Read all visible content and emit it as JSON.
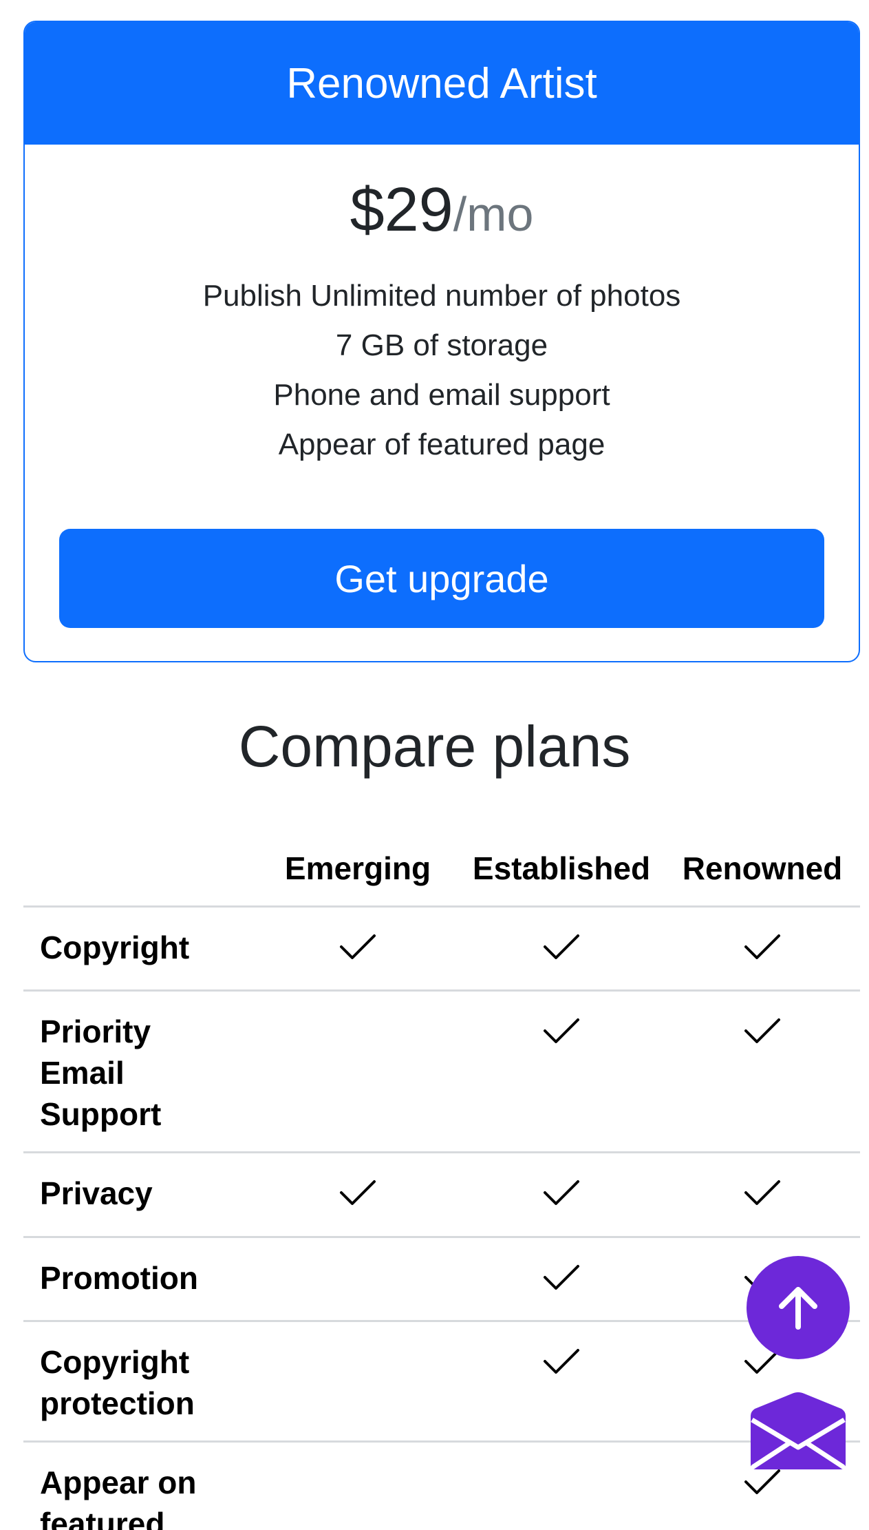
{
  "plan_card": {
    "title": "Renowned Artist",
    "price": "$29",
    "period": "/mo",
    "features": [
      "Publish Unlimited number of photos",
      "7 GB of storage",
      "Phone and email support",
      "Appear of featured page"
    ],
    "button_label": "Get upgrade"
  },
  "compare": {
    "title": "Compare plans",
    "columns": [
      "Emerging",
      "Established",
      "Renowned"
    ],
    "rows": [
      {
        "label": "Copyright",
        "checks": [
          true,
          true,
          true
        ]
      },
      {
        "label": "Priority Email Support",
        "checks": [
          false,
          true,
          true
        ]
      },
      {
        "label": "Privacy",
        "checks": [
          true,
          true,
          true
        ]
      },
      {
        "label": "Promotion",
        "checks": [
          false,
          true,
          true
        ]
      },
      {
        "label": "Copyright protection",
        "checks": [
          false,
          true,
          true
        ]
      },
      {
        "label": "Appear on featured",
        "checks": [
          false,
          false,
          true
        ]
      }
    ]
  },
  "floating_actions": {
    "scroll_top_icon": "arrow-up-icon",
    "mail_icon": "envelope-open-icon",
    "color": "#6d28d9"
  },
  "colors": {
    "primary": "#0d6efd",
    "accent": "#6d28d9",
    "divider": "#d7dadd"
  }
}
